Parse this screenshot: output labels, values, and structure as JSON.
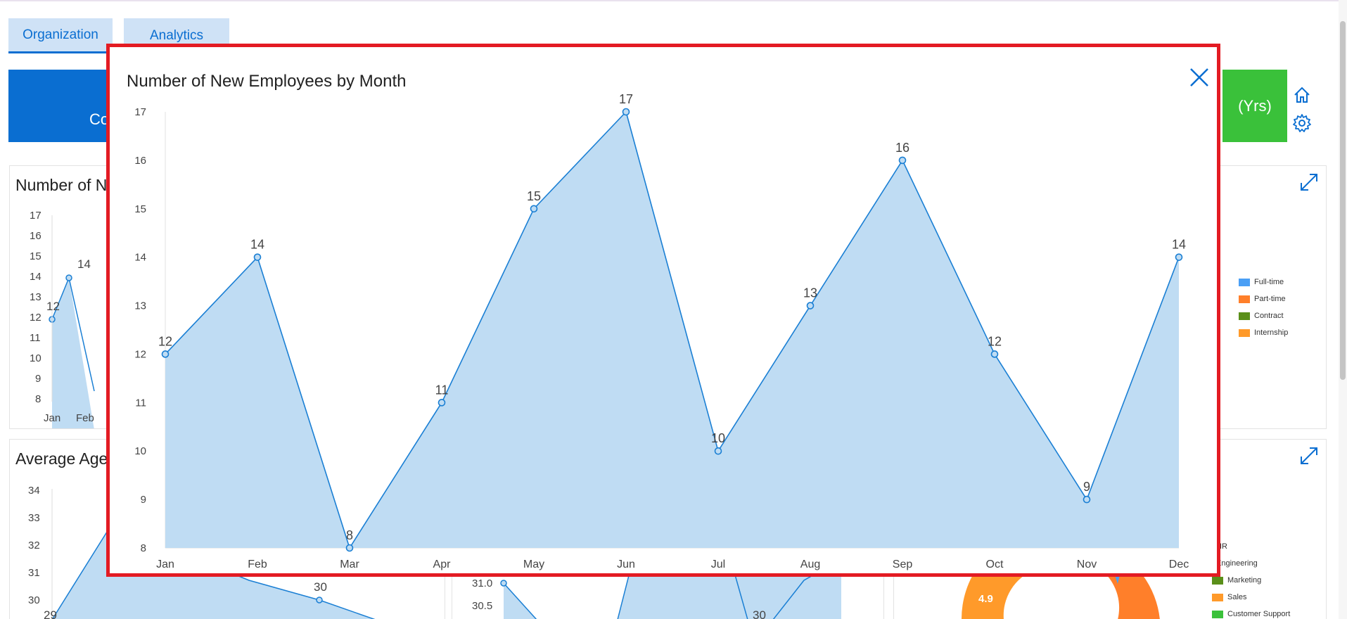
{
  "tabs": [
    {
      "label": "Organization",
      "active": true
    },
    {
      "label": "Analytics",
      "active": false
    }
  ],
  "kpi": {
    "left_text": "Co",
    "right_text": "(Yrs)"
  },
  "background_cards": {
    "new_employees_title": "Number of N",
    "average_age_title": "Average Age",
    "mini_chart": {
      "y_ticks": [
        "17",
        "16",
        "15",
        "14",
        "13",
        "12",
        "11",
        "10",
        "9",
        "8"
      ],
      "x_ticks": [
        "Jan",
        "Feb"
      ],
      "labels": [
        "12",
        "14"
      ]
    },
    "age_chart": {
      "y_ticks": [
        "34",
        "33",
        "32",
        "31",
        "30",
        "29"
      ],
      "labels": [
        "30"
      ]
    },
    "tenure_chart": {
      "y_ticks": [
        "31.0",
        "30.5"
      ],
      "labels": [
        "30"
      ]
    },
    "employment_legend": [
      "Full-time",
      "Part-time",
      "Contract",
      "Internship"
    ],
    "department_legend": [
      "HR",
      "Engineering",
      "Marketing",
      "Sales",
      "Customer Support"
    ],
    "donut_label": "4.9"
  },
  "modal": {
    "title": "Number of New Employees by Month",
    "close_icon": "close-icon"
  },
  "colors": {
    "accent": "#0a6ed1",
    "area_fill": "#bfdcf3",
    "line": "#1a7fd4",
    "modal_border": "#e31b23",
    "kpi_green": "#3ac13a",
    "legend": [
      "#4a9ff5",
      "#ff7f2a",
      "#5a8f1a",
      "#ff9a2a",
      "#3ac13a"
    ]
  },
  "chart_data": {
    "type": "area",
    "title": "Number of New Employees by Month",
    "categories": [
      "Jan",
      "Feb",
      "Mar",
      "Apr",
      "May",
      "Jun",
      "Jul",
      "Aug",
      "Sep",
      "Oct",
      "Nov",
      "Dec"
    ],
    "values": [
      12,
      14,
      8,
      11,
      15,
      17,
      10,
      13,
      16,
      12,
      9,
      14
    ],
    "y_ticks": [
      17,
      16,
      15,
      14,
      13,
      12,
      11,
      10,
      9,
      8
    ],
    "ylim": [
      8,
      17
    ],
    "data_labels": true,
    "grid": false,
    "legend": "none"
  }
}
